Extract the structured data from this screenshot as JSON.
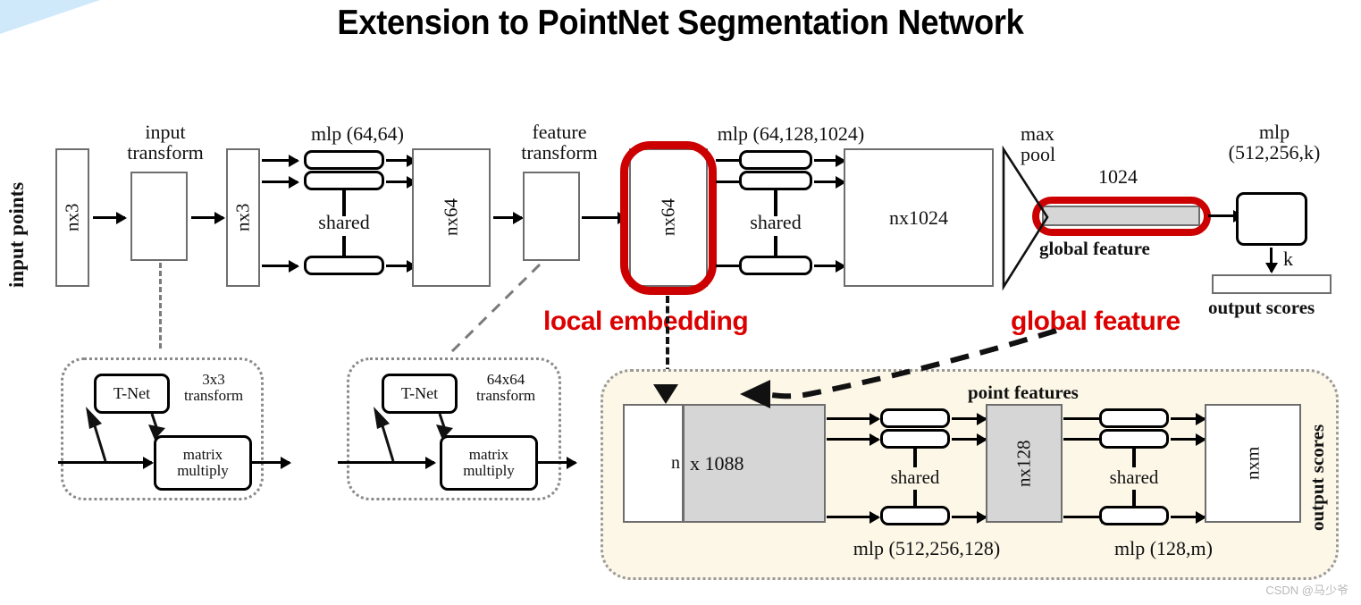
{
  "page": {
    "title": "Extension to PointNet Segmentation Network",
    "watermark": "CSDN @马少爷"
  },
  "classification_network": {
    "input_label": "input points",
    "blocks": {
      "nx3_a": "nx3",
      "input_transform_caption": "input\ntransform",
      "nx3_b": "nx3",
      "mlp_64_64": "mlp (64,64)",
      "shared_1": "shared",
      "nx64_a": "nx64",
      "feature_transform_caption": "feature\ntransform",
      "nx64_b": "nx64",
      "mlp_64_128_1024": "mlp (64,128,1024)",
      "shared_2": "shared",
      "nx1024": "nx1024",
      "max_pool": "max\npool",
      "global_feature_size": "1024",
      "global_feature_label": "global feature",
      "mlp_512_256_k": "mlp\n(512,256,k)",
      "k_label": "k",
      "output_scores_label": "output scores"
    }
  },
  "annotations": {
    "local_embedding": "local embedding",
    "global_feature": "global feature",
    "accent_color": "#dd0000"
  },
  "tnet_input": {
    "tnet_label": "T-Net",
    "transform_label": "3x3\ntransform",
    "matrix_multiply_label": "matrix\nmultiply"
  },
  "tnet_feature": {
    "tnet_label": "T-Net",
    "transform_label": "64x64\ntransform",
    "matrix_multiply_label": "matrix\nmultiply"
  },
  "segmentation_network": {
    "point_features_label": "point features",
    "n_label": "n",
    "x1088_label": "x 1088",
    "shared_1": "shared",
    "mlp_512_256_128": "mlp (512,256,128)",
    "nx128": "nx128",
    "shared_2": "shared",
    "mlp_128_m": "mlp (128,m)",
    "nxm": "nxm",
    "output_scores_label": "output scores"
  }
}
